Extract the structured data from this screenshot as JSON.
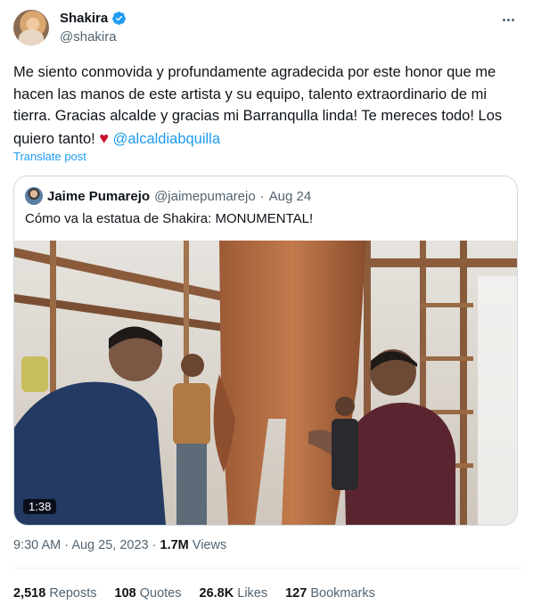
{
  "author": {
    "display_name": "Shakira",
    "handle": "@shakira"
  },
  "tweet": {
    "text_before_heart": "Me siento conmovida y profundamente agradecida por este honor que me hacen las manos de este artista y su equipo, talento extraordinario de mi tierra. Gracias alcalde y gracias mi Barranqulla linda! Te mereces todo! Los quiero tanto! ",
    "heart_emoji": "♥",
    "mention": "@alcaldiabquilla",
    "translate_label": "Translate post"
  },
  "quoted": {
    "display_name": "Jaime Pumarejo",
    "handle": "@jaimepumarejo",
    "separator": "·",
    "date": "Aug 24",
    "text": "Cómo va la estatua de Shakira: MONUMENTAL!",
    "video_duration": "1:38"
  },
  "meta": {
    "time": "9:30 AM",
    "separator": "·",
    "date": "Aug 25, 2023",
    "views_count": "1.7M",
    "views_label": "Views"
  },
  "stats": {
    "reposts_count": "2,518",
    "reposts_label": "Reposts",
    "quotes_count": "108",
    "quotes_label": "Quotes",
    "likes_count": "26.8K",
    "likes_label": "Likes",
    "bookmarks_count": "127",
    "bookmarks_label": "Bookmarks"
  },
  "colors": {
    "link": "#1d9bf0",
    "verified": "#1d9bf0",
    "heart": "#c8102e",
    "secondary_text": "#536471"
  }
}
